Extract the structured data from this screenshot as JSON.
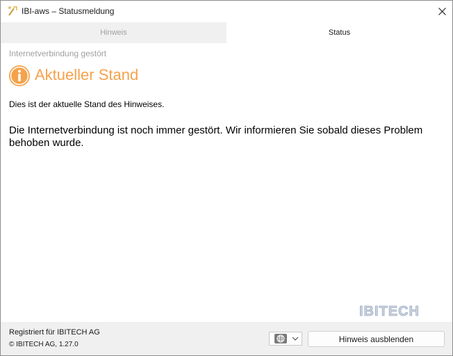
{
  "window": {
    "title": "IBI-aws – Statusmeldung"
  },
  "tabs": [
    {
      "label": "Hinweis",
      "active": false
    },
    {
      "label": "Status",
      "active": true
    }
  ],
  "content": {
    "subtitle": "Internetverbindung gestört",
    "heading": "Aktueller Stand",
    "intro": "Dies ist der aktuelle Stand des Hinweises.",
    "message": "Die Internetverbindung ist noch immer gestört. Wir informieren Sie sobald dieses Problem behoben wurde."
  },
  "logo": {
    "text": "IBITECH"
  },
  "footer": {
    "registered": "Registriert für IBITECH AG",
    "copyright": "© IBITECH AG, 1.27.0",
    "language_icon": "globe-icon",
    "hide_button": "Hinweis ausblenden"
  },
  "colors": {
    "accent": "#f5a24c",
    "logo_gray": "#d2d4d6",
    "logo_blue": "#7d98c3"
  }
}
